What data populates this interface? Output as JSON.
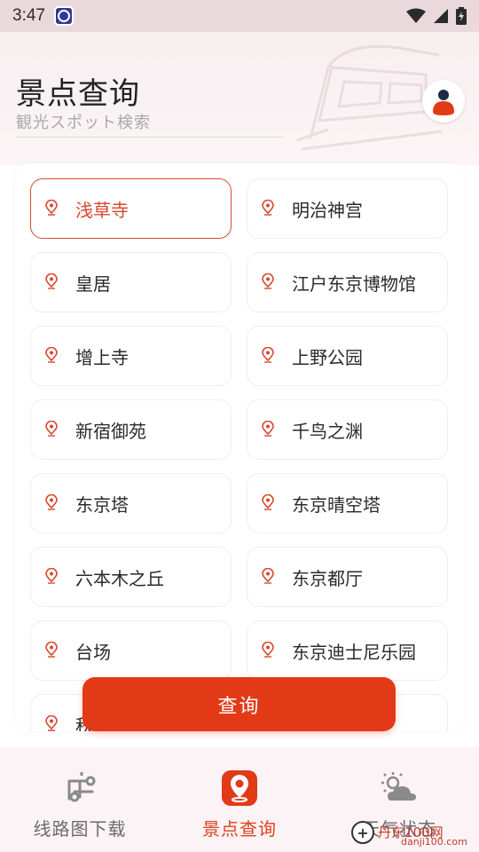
{
  "status": {
    "time": "3:47"
  },
  "header": {
    "title": "景点查询",
    "subtitle": "観光スポット検索"
  },
  "spots": [
    {
      "label": "浅草寺",
      "selected": true
    },
    {
      "label": "明治神宫",
      "selected": false
    },
    {
      "label": "皇居",
      "selected": false
    },
    {
      "label": "江户东京博物馆",
      "selected": false
    },
    {
      "label": "增上寺",
      "selected": false
    },
    {
      "label": "上野公园",
      "selected": false
    },
    {
      "label": "新宿御苑",
      "selected": false
    },
    {
      "label": "千鸟之渊",
      "selected": false
    },
    {
      "label": "东京塔",
      "selected": false
    },
    {
      "label": "东京晴空塔",
      "selected": false
    },
    {
      "label": "六本木之丘",
      "selected": false
    },
    {
      "label": "东京都厅",
      "selected": false
    },
    {
      "label": "台场",
      "selected": false
    },
    {
      "label": "东京迪士尼乐园",
      "selected": false
    },
    {
      "label": "秋",
      "selected": false
    },
    {
      "label": "",
      "selected": false
    }
  ],
  "query_button": {
    "label": "查询"
  },
  "bottom_nav": {
    "items": [
      {
        "label": "线路图下载",
        "icon": "route-map-icon",
        "active": false
      },
      {
        "label": "景点查询",
        "icon": "location-pin-icon",
        "active": true
      },
      {
        "label": "天气状态",
        "icon": "weather-icon",
        "active": false
      }
    ]
  },
  "watermark": {
    "text": "丹东100网",
    "sub": "danji100.com"
  },
  "colors": {
    "accent": "#e23a17",
    "selected_text": "#d9472f",
    "nav_background": "#fbf3f5",
    "header_background": "#f7eef0"
  }
}
